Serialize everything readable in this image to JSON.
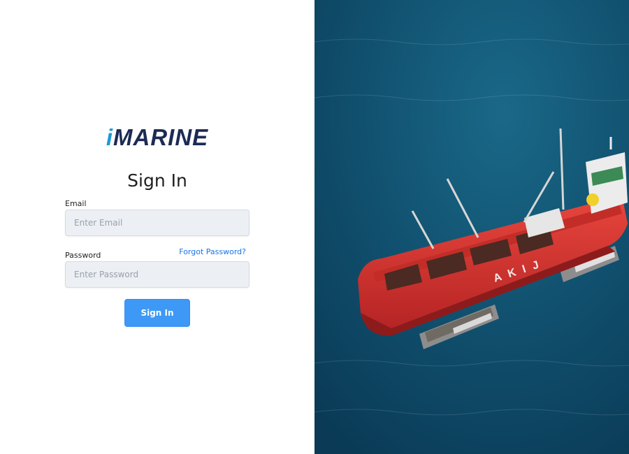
{
  "brand": {
    "logo_i": "i",
    "logo_rest": "MARINE"
  },
  "form": {
    "title": "Sign In",
    "email_label": "Email",
    "email_placeholder": "Enter Email",
    "password_label": "Password",
    "password_placeholder": "Enter Password",
    "forgot_label": "Forgot Password?",
    "submit_label": "Sign In"
  },
  "hero": {
    "ship_name": "A K I J"
  },
  "colors": {
    "brand_navy": "#1d2a55",
    "brand_cyan": "#1a9ad6",
    "link_blue": "#1a73e8",
    "button_blue": "#3d99f5",
    "sea": "#0f4c6a",
    "hull_red": "#d8302c"
  }
}
